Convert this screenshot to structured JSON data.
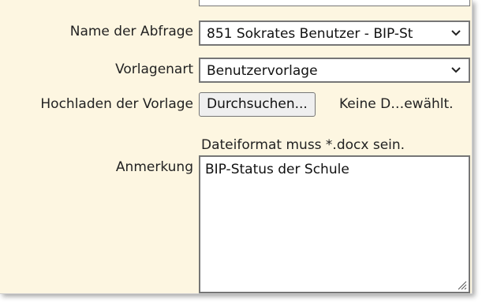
{
  "form": {
    "query_name": {
      "label": "Name der Abfrage",
      "value": "851 Sokrates Benutzer - BIP-St"
    },
    "template_type": {
      "label": "Vorlagenart",
      "value": "Benutzervorlage"
    },
    "upload": {
      "label": "Hochladen der Vorlage",
      "button_label": "Durchsuchen...",
      "status": "Keine D…ewählt.",
      "hint": "Dateiformat muss *.docx sein."
    },
    "remark": {
      "label": "Anmerkung",
      "value": "BIP-Status der Schule"
    }
  },
  "colors": {
    "panel_background": "#fdf6e1",
    "control_border": "#767676",
    "button_background": "#efefef"
  },
  "icons": {
    "dropdown": "chevron-down-icon",
    "resize": "resize-grip-icon"
  }
}
